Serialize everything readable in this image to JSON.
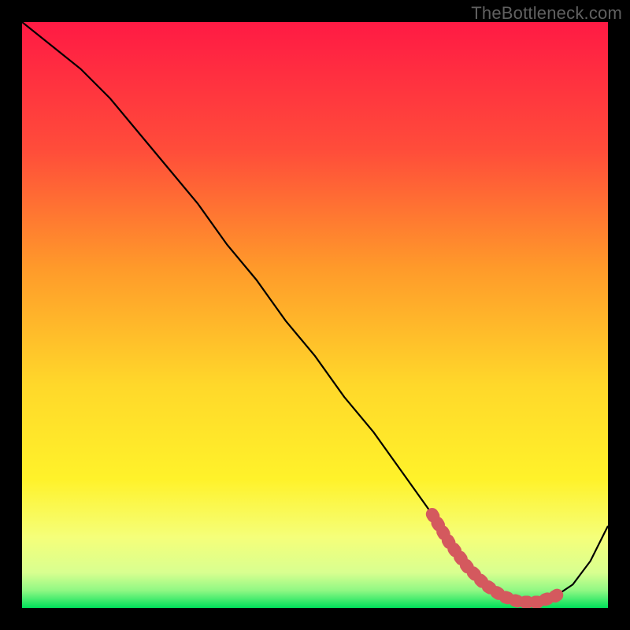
{
  "watermark": "TheBottleneck.com",
  "chart_data": {
    "type": "line",
    "title": "",
    "xlabel": "",
    "ylabel": "",
    "xlim": [
      0,
      100
    ],
    "ylim": [
      0,
      100
    ],
    "grid": false,
    "background_gradient": {
      "top": "#ff1a44",
      "upper_mid": "#ff8a2a",
      "mid": "#ffe22a",
      "lower_mid": "#f5ff7a",
      "near_bottom": "#c8ff9a",
      "bottom": "#00e05a"
    },
    "series": [
      {
        "name": "curve",
        "color": "#000000",
        "x": [
          0,
          5,
          10,
          15,
          20,
          25,
          30,
          35,
          40,
          45,
          50,
          55,
          60,
          65,
          70,
          73,
          76,
          79,
          82,
          85,
          88,
          91,
          94,
          97,
          100
        ],
        "y": [
          100,
          96,
          92,
          87,
          81,
          75,
          69,
          62,
          56,
          49,
          43,
          36,
          30,
          23,
          16,
          11,
          7,
          4,
          2,
          1,
          1,
          2,
          4,
          8,
          14
        ]
      }
    ],
    "highlight_band": {
      "name": "optimal-range",
      "color": "#d4595e",
      "x_start": 70,
      "x_end": 92,
      "y": 1.5,
      "thickness": 2.2
    }
  }
}
